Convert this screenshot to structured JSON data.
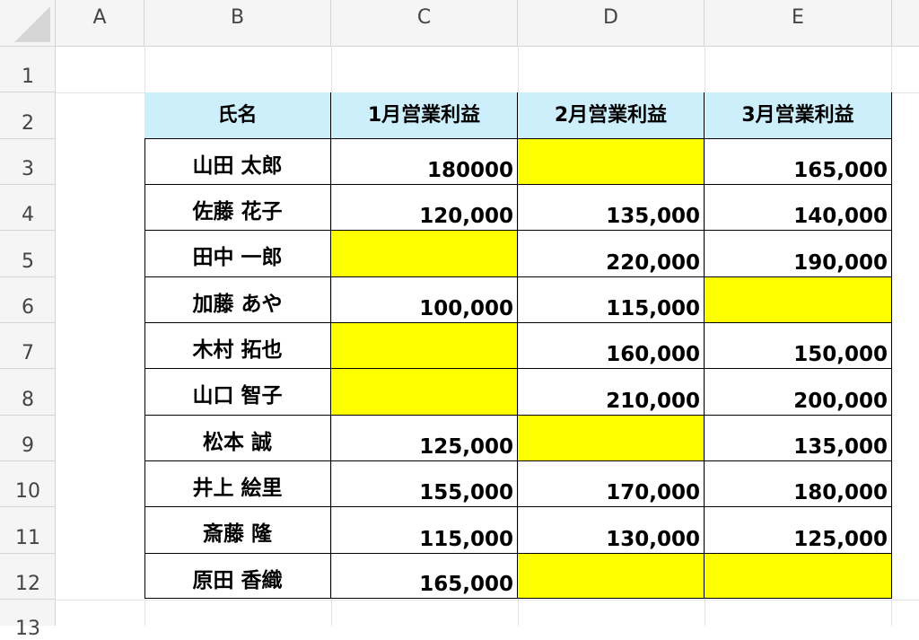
{
  "columns": [
    "A",
    "B",
    "C",
    "D",
    "E"
  ],
  "rows": [
    "1",
    "2",
    "3",
    "4",
    "5",
    "6",
    "7",
    "8",
    "9",
    "10",
    "11",
    "12",
    "13"
  ],
  "colors": {
    "header_fill": "#cdeefb",
    "highlight_fill": "#ffff00"
  },
  "table": {
    "headers": [
      "氏名",
      "1月営業利益",
      "2月営業利益",
      "3月営業利益"
    ],
    "records": [
      {
        "name": "山田 太郎",
        "m1": "180000",
        "m2": "",
        "m3": "165,000",
        "hl": [
          false,
          true,
          false
        ]
      },
      {
        "name": "佐藤 花子",
        "m1": "120,000",
        "m2": "135,000",
        "m3": "140,000",
        "hl": [
          false,
          false,
          false
        ]
      },
      {
        "name": "田中 一郎",
        "m1": "",
        "m2": "220,000",
        "m3": "190,000",
        "hl": [
          true,
          false,
          false
        ]
      },
      {
        "name": "加藤 あや",
        "m1": "100,000",
        "m2": "115,000",
        "m3": "",
        "hl": [
          false,
          false,
          true
        ]
      },
      {
        "name": "木村 拓也",
        "m1": "",
        "m2": "160,000",
        "m3": "150,000",
        "hl": [
          true,
          false,
          false
        ]
      },
      {
        "name": "山口 智子",
        "m1": "",
        "m2": "210,000",
        "m3": "200,000",
        "hl": [
          true,
          false,
          false
        ]
      },
      {
        "name": "松本 誠",
        "m1": "125,000",
        "m2": "",
        "m3": "135,000",
        "hl": [
          false,
          true,
          false
        ]
      },
      {
        "name": "井上 絵里",
        "m1": "155,000",
        "m2": "170,000",
        "m3": "180,000",
        "hl": [
          false,
          false,
          false
        ]
      },
      {
        "name": "斎藤 隆",
        "m1": "115,000",
        "m2": "130,000",
        "m3": "125,000",
        "hl": [
          false,
          false,
          false
        ]
      },
      {
        "name": "原田 香織",
        "m1": "165,000",
        "m2": "",
        "m3": "",
        "hl": [
          false,
          true,
          true
        ]
      }
    ]
  }
}
